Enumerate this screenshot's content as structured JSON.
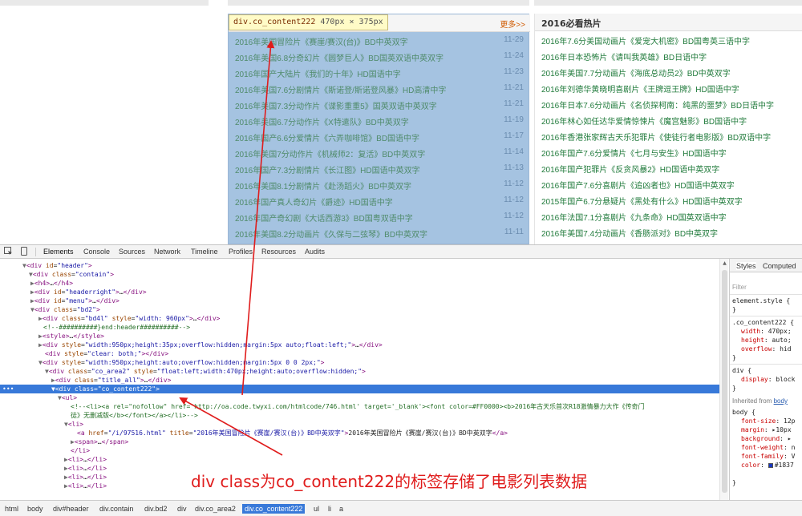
{
  "page": {
    "left_list": {
      "more_label": "更多>>",
      "tooltip": {
        "name": "div.co_content222",
        "dims": "470px × 375px"
      },
      "items": [
        {
          "title": "2016年美国冒险片《赛崖/赛汉(台)》BD中英双字",
          "date": "11-29"
        },
        {
          "title": "2016年美国6.8分奇幻片《圆梦巨人》BD国英双语中英双字",
          "date": "11-24"
        },
        {
          "title": "2016年国产大陆片《我们的十年》HD国语中字",
          "date": "11-23"
        },
        {
          "title": "2016年美国7.6分剧情片《斯诺登/斯诺登风暴》HD高清中字",
          "date": "11-21"
        },
        {
          "title": "2016年美国7.3分动作片《谍影重重5》国英双语中英双字",
          "date": "11-21"
        },
        {
          "title": "2016年美国6.7分动作片《X特遣队》BD中英双字",
          "date": "11-19"
        },
        {
          "title": "2016年国产6.6分爱情片《六弄咖啡馆》BD国语中字",
          "date": "11-17"
        },
        {
          "title": "2016年美国7分动作片《机械师2：复活》BD中英双字",
          "date": "11-14"
        },
        {
          "title": "2016年国产7.3分剧情片《长江图》HD国语中英双字",
          "date": "11-13"
        },
        {
          "title": "2016年美国8.1分剧情片《赴汤蹈火》BD中英双字",
          "date": "11-12"
        },
        {
          "title": "2016年国产真人奇幻片《爵迹》HD国语中字",
          "date": "11-12"
        },
        {
          "title": "2016年国产奇幻剧《大话西游3》BD国粤双语中字",
          "date": "11-12"
        },
        {
          "title": "2016年美国8.2分动画片《久保与二弦琴》BD中英双字",
          "date": "11-11"
        }
      ]
    },
    "right_list": {
      "title": "2016必看热片",
      "items": [
        "2016年7.6分美国动画片《爱宠大机密》BD国粤英三语中字",
        "2016年日本恐怖片《请叫我英雄》BD日语中字",
        "2016年美国7.7分动画片《海底总动员2》BD中英双字",
        "2016年刘德华黄晓明喜剧片《王牌逗王牌》HD国语中字",
        "2016年日本7.6分动画片《名侦探柯南：纯黑的噩梦》BD日语中字",
        "2016年林心如任达华爱情惊悚片《魔宫魅影》BD国语中字",
        "2016年香港张家辉古天乐犯罪片《使徒行者电影版》BD双语中字",
        "2016年国产7.6分爱情片《七月与安生》HD国语中字",
        "2016年国产犯罪片《反贪风暴2》HD国语中英双字",
        "2016年国产7.6分喜剧片《追凶者也》HD国语中英双字",
        "2015年国产6.7分悬疑片《黑处有什么》HD国语中英双字",
        "2016年法国7.1分喜剧片《九条命》HD国英双语中字",
        "2016年美国7.4分动画片《香肠派对》BD中英双字"
      ]
    }
  },
  "devtools": {
    "tabs": [
      "Elements",
      "Console",
      "Sources",
      "Network",
      "Timeline",
      "Profiles",
      "Resources",
      "Audits"
    ],
    "active_tab": "Elements",
    "dom": [
      {
        "html": "<span class='tri'>▼</span><span class='tg'>&lt;div</span> <span class='an'>id</span>=<span class='av'>\"header\"</span><span class='tg'>&gt;</span>"
      },
      {
        "html": "<span class='tri'>▼</span><span class='tg'>&lt;div</span> <span class='an'>class</span>=<span class='av'>\"contain\"</span><span class='tg'>&gt;</span>"
      },
      {
        "html": "<span class='tri'>▶</span><span class='tg'>&lt;h4&gt;</span>…<span class='tg'>&lt;/h4&gt;</span>"
      },
      {
        "html": "<span class='tri'>▶</span><span class='tg'>&lt;div</span> <span class='an'>id</span>=<span class='av'>\"headerright\"</span><span class='tg'>&gt;</span>…<span class='tg'>&lt;/div&gt;</span>"
      },
      {
        "html": "<span class='tri'>▶</span><span class='tg'>&lt;div</span> <span class='an'>id</span>=<span class='av'>\"menu\"</span><span class='tg'>&gt;</span>…<span class='tg'>&lt;/div&gt;</span>"
      },
      {
        "html": "<span class='tri'>▼</span><span class='tg'>&lt;div</span> <span class='an'>class</span>=<span class='av'>\"bd2\"</span><span class='tg'>&gt;</span>"
      },
      {
        "html": "<span class='tri'>▶</span><span class='tg'>&lt;div</span> <span class='an'>class</span>=<span class='av'>\"bd4l\"</span> <span class='an'>style</span>=<span class='av'>\"width: 960px\"</span><span class='tg'>&gt;</span>…<span class='tg'>&lt;/div&gt;</span>"
      },
      {
        "html": "<span class='cm'>&lt;!--##########}end:header##########--&gt;</span>"
      },
      {
        "html": "<span class='tri'>▶</span><span class='tg'>&lt;style&gt;</span>…<span class='tg'>&lt;/style&gt;</span>"
      },
      {
        "html": "<span class='tri'>▶</span><span class='tg'>&lt;div</span> <span class='an'>style</span>=<span class='av'>\"width:950px;height:35px;overflow:hidden;margin:5px auto;float:left;\"</span><span class='tg'>&gt;</span>…<span class='tg'>&lt;/div&gt;</span>"
      },
      {
        "html": "<span class='tg'>&lt;div</span> <span class='an'>style</span>=<span class='av'>\"clear: both;\"</span><span class='tg'>&gt;&lt;/div&gt;</span>"
      },
      {
        "html": "<span class='tri'>▼</span><span class='tg'>&lt;div</span> <span class='an'>style</span>=<span class='av'>\"width:950px;height:auto;overflow:hidden;margin:5px 0 0 2px;\"</span><span class='tg'>&gt;</span>"
      },
      {
        "html": "<span class='tri'>▼</span><span class='tg'>&lt;div</span> <span class='an'>class</span>=<span class='av'>\"co_area2\"</span> <span class='an'>style</span>=<span class='av'>\"float:left;width:470px;height:auto;overflow:hidden;\"</span><span class='tg'>&gt;</span>"
      },
      {
        "html": "<span class='tri'>▶</span><span class='tg'>&lt;div</span> <span class='an'>class</span>=<span class='av'>\"title_all\"</span><span class='tg'>&gt;</span>…<span class='tg'>&lt;/div&gt;</span>"
      },
      {
        "html": "<span class='tri'>▼</span><span class='tg'>&lt;div</span> <span class='an'>class</span>=<span class='av'>\"co_content222\"</span><span class='tg'>&gt;</span>",
        "selected": true
      },
      {
        "html": "<span class='tri'>▼</span><span class='tg'>&lt;ul&gt;</span>"
      },
      {
        "html": "<span class='cm'>&lt;!--&lt;li&gt;&lt;a rel=\"nofollow\" href='http://oa.code.twyxi.com/htmlcode/746.html'  target='_blank'&gt;&lt;font color=#FF0000&gt;&lt;b&gt;2016年古天乐首次R18激情暴力大作《传奇门</span>"
      },
      {
        "html": "<span class='cm'>徒》无删减版&lt;/b&gt;&lt;/font&gt;&lt;/a&gt;&lt;/li&gt;--&gt;</span>"
      },
      {
        "html": "<span class='tri'>▼</span><span class='tg'>&lt;li&gt;</span>"
      },
      {
        "html": "<span class='tg'>&lt;a</span> <span class='an'>href</span>=<span class='av'>\"/i/97516.html\"</span> <span class='an'>title</span>=<span class='av'>\"2016年美国冒险片《赛崖/赛汉(台)》BD中英双字\"</span><span class='tg'>&gt;</span><span class='tx'>2016年美国冒险片《赛崖/赛汉(台)》BD中英双字</span><span class='tg'>&lt;/a&gt;</span>"
      },
      {
        "html": "<span class='tri'>▶</span><span class='tg'>&lt;span&gt;</span>…<span class='tg'>&lt;/span&gt;</span>"
      },
      {
        "html": "<span class='tg'>&lt;/li&gt;</span>"
      },
      {
        "html": "<span class='tri'>▶</span><span class='tg'>&lt;li&gt;</span>…<span class='tg'>&lt;/li&gt;</span>"
      },
      {
        "html": "<span class='tri'>▶</span><span class='tg'>&lt;li&gt;</span>…<span class='tg'>&lt;/li&gt;</span>"
      },
      {
        "html": "<span class='tri'>▶</span><span class='tg'>&lt;li&gt;</span>…<span class='tg'>&lt;/li&gt;</span>"
      },
      {
        "html": "<span class='tri'>▶</span><span class='tg'>&lt;li&gt;</span>…<span class='tg'>&lt;/li&gt;</span>"
      }
    ],
    "styles": {
      "tabs": [
        "Styles",
        "Computed"
      ],
      "filter_placeholder": "Filter",
      "element_style": "element.style {",
      "close_brace": "}",
      "rule1_selector": ".co_content222 {",
      "rule1_props": [
        {
          "p": "width",
          "v": "470px;"
        },
        {
          "p": "height",
          "v": "auto;"
        },
        {
          "p": "overflow",
          "v": "hid"
        }
      ],
      "rule2_selector": "div {",
      "rule2_props": [
        {
          "p": "display",
          "v": "block"
        }
      ],
      "inherited_label": "Inherited from",
      "inherited_from": "body",
      "body_selector": "body {",
      "body_props": [
        {
          "p": "font-size",
          "v": "12p"
        },
        {
          "p": "margin",
          "v": "▸10px"
        },
        {
          "p": "background",
          "v": "▸"
        },
        {
          "p": "font-weight",
          "v": "n"
        },
        {
          "p": "font-family",
          "v": "V"
        },
        {
          "p": "color",
          "v": "#1837"
        }
      ]
    },
    "breadcrumbs": [
      "html",
      "body",
      "div#header",
      "div.contain",
      "div.bd2",
      "div",
      "div.co_area2",
      "div.co_content222",
      "ul",
      "li",
      "a"
    ],
    "active_breadcrumb": "div.co_content222"
  },
  "annotation": {
    "caption": "div class为co_content222的标签存储了电影列表数据",
    "color": "#e01c1c"
  }
}
